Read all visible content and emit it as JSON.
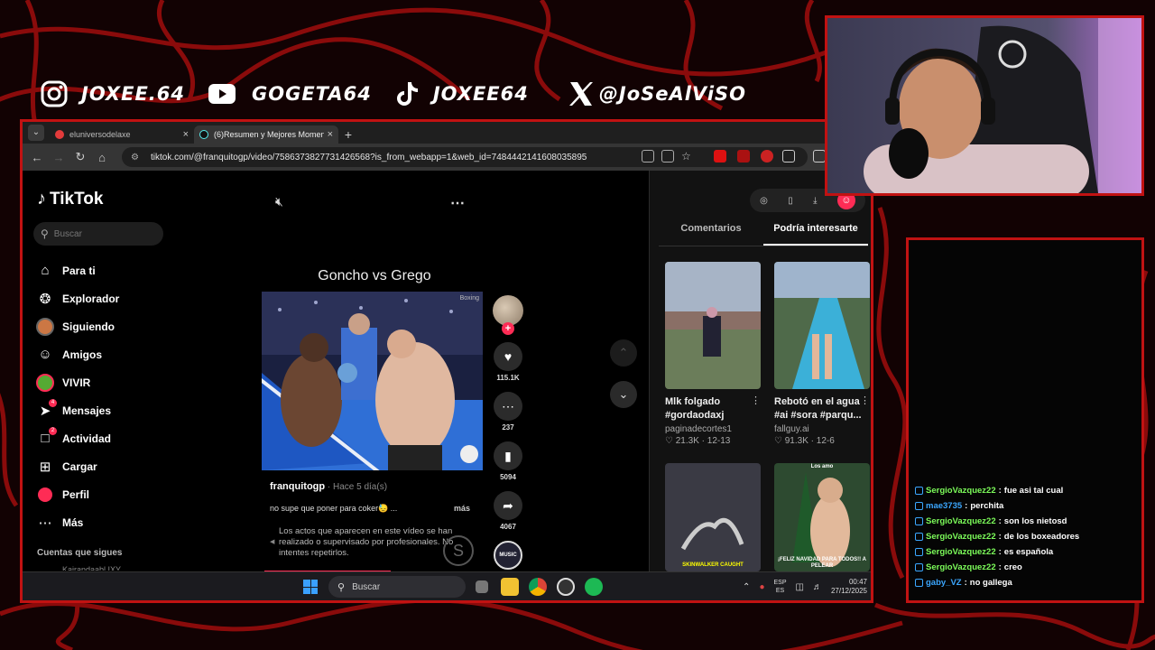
{
  "socials": [
    {
      "platform_icon": "instagram-icon",
      "handle": "JOXEE.64"
    },
    {
      "platform_icon": "youtube-icon",
      "handle": "GOGETA64"
    },
    {
      "platform_icon": "tiktok-icon",
      "handle": "JOXEE64"
    },
    {
      "platform_icon": "x-icon",
      "handle": "@JoSeAlViSO"
    }
  ],
  "browser": {
    "tabs": [
      {
        "title": "eluniversodelaxe",
        "active": false
      },
      {
        "title": "(6)Resumen y Mejores Moments",
        "active": true
      }
    ],
    "url": "tiktok.com/@franquitogp/video/7586373827731426568?is_from_webapp=1&web_id=7484442141608035895"
  },
  "tiktok": {
    "logo_text": "TikTok",
    "search_placeholder": "Buscar",
    "nav": [
      {
        "label": "Para ti",
        "icon": "home-icon"
      },
      {
        "label": "Explorador",
        "icon": "compass-icon"
      },
      {
        "label": "Siguiendo",
        "icon": "following-avatar-icon"
      },
      {
        "label": "Amigos",
        "icon": "friends-icon"
      },
      {
        "label": "VIVIR",
        "icon": "live-icon"
      },
      {
        "label": "Mensajes",
        "icon": "messages-icon",
        "badge": "4"
      },
      {
        "label": "Actividad",
        "icon": "activity-icon",
        "badge": "2"
      },
      {
        "label": "Cargar",
        "icon": "upload-icon"
      },
      {
        "label": "Perfil",
        "icon": "profile-icon"
      },
      {
        "label": "Más",
        "icon": "more-icon"
      }
    ],
    "following_heading": "Cuentas que sigues",
    "following_first": "Kairandaabl IXY",
    "video": {
      "title": "Goncho vs Grego",
      "overlay_brand": "Boxing",
      "author": "franquitogp",
      "age": " · Hace 5 día(s)",
      "description": "no supe que poner para coker😓 ...",
      "more_label": "más",
      "warning": "Los actos que aparecen en este vídeo se han realizado o supervisado por profesionales. No intentes repetirlos."
    },
    "actions": {
      "likes": "115.1K",
      "comments": "237",
      "saves": "5094",
      "shares": "4067",
      "music_label": "MUSIC"
    },
    "right_tabs": [
      "Comentarios",
      "Podría interesarte"
    ],
    "active_right_tab": 1,
    "suggestions": [
      {
        "title": "Mlk folgado #gordaodaxj",
        "author": "paginadecortes1",
        "stats": "♡ 21.3K · 12-13"
      },
      {
        "title": "Rebotó en el agua #ai #sora #parqu...",
        "author": "fallguy.ai",
        "stats": "♡ 91.3K · 12-6"
      },
      {
        "title": "",
        "author": "",
        "stats": "",
        "overlay": "SKINWALKER CAUGHT"
      },
      {
        "title": "",
        "author": "",
        "stats": "",
        "overlay": "¡FELIZ NAVIDAD PARA TODOS!! A PELEAR",
        "top_overlay": "Los amo"
      }
    ]
  },
  "taskbar": {
    "search_placeholder": "Buscar",
    "lang_top": "ESP",
    "lang_bottom": "ES",
    "time": "00:47",
    "date": "27/12/2025"
  },
  "chat": [
    {
      "user": "SergioVazquez22",
      "color": "#7cfc5a",
      "badge_color": "#3ba7ff",
      "text": "fue asi tal cual"
    },
    {
      "user": "mae3735",
      "color": "#3ba7ff",
      "badge_color": "#3ba7ff",
      "text": "perchita"
    },
    {
      "user": "SergioVazquez22",
      "color": "#7cfc5a",
      "badge_color": "#3ba7ff",
      "text": "son los nietosd"
    },
    {
      "user": "SergioVazquez22",
      "color": "#7cfc5a",
      "badge_color": "#3ba7ff",
      "text": "de los boxeadores"
    },
    {
      "user": "SergioVazquez22",
      "color": "#7cfc5a",
      "badge_color": "#3ba7ff",
      "text": "es española"
    },
    {
      "user": "SergioVazquez22",
      "color": "#7cfc5a",
      "badge_color": "#3ba7ff",
      "text": "creo"
    },
    {
      "user": "gaby_VZ",
      "color": "#3ba7ff",
      "badge_color": "#3ba7ff",
      "text": "no gallega"
    }
  ],
  "colors": {
    "frame_red": "#c11212",
    "tiktok_pink": "#fe2c55",
    "bg_dark": "#140203"
  }
}
